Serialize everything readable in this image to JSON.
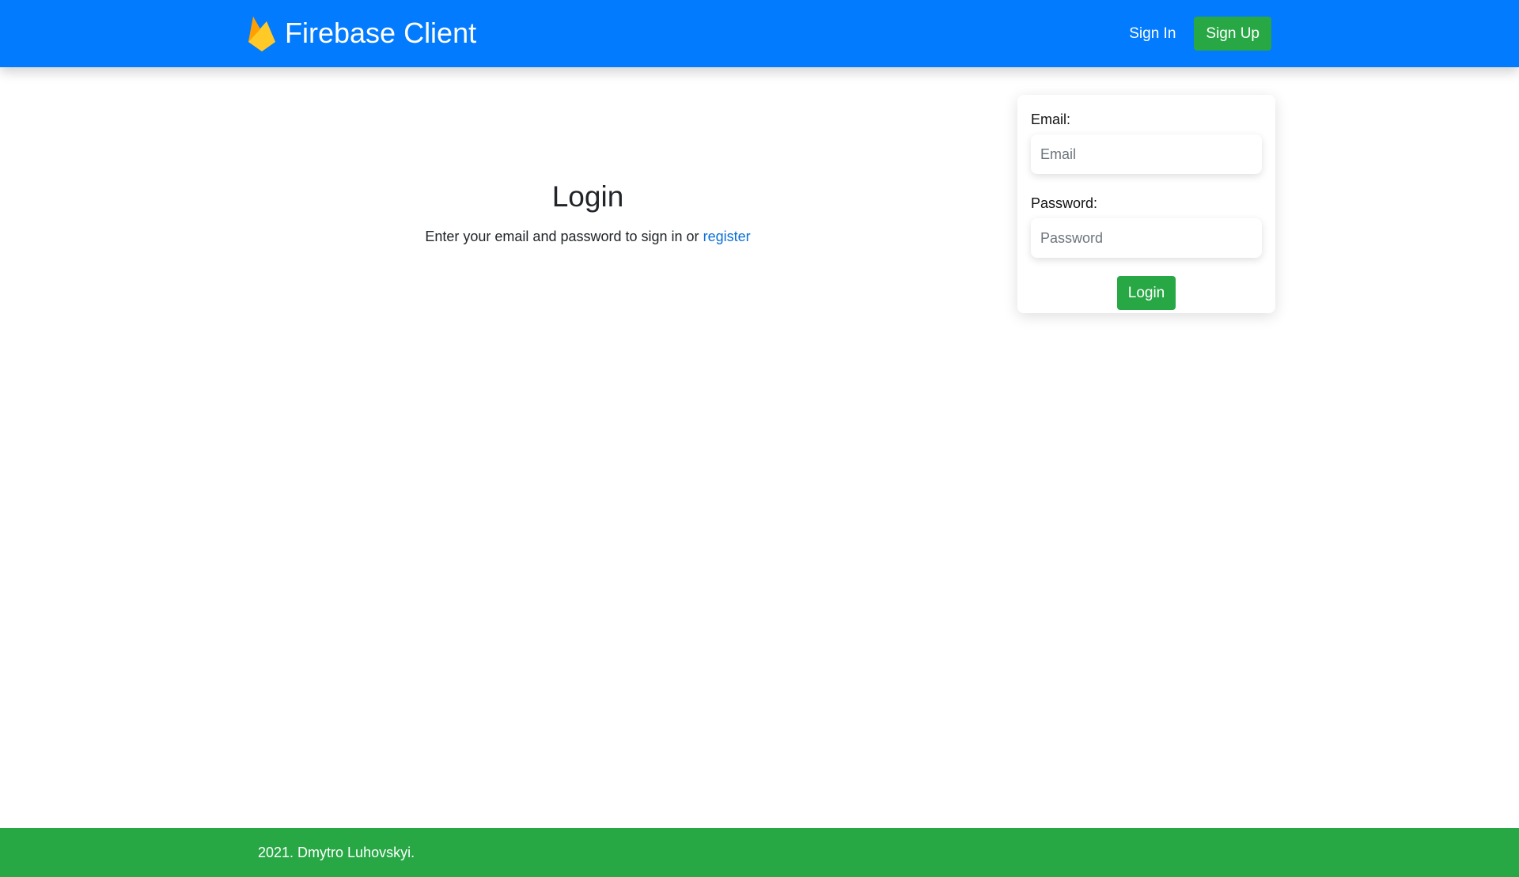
{
  "navbar": {
    "brand_name": "Firebase Client",
    "logo_icon": "firebase-flame-icon",
    "sign_in_label": "Sign In",
    "sign_up_label": "Sign Up",
    "background_color": "#037bfe"
  },
  "hero": {
    "title": "Login",
    "text": "Enter your email and password to sign in or",
    "register_link": "register"
  },
  "login_form": {
    "email_label": "Email:",
    "email_placeholder": "Email",
    "email_value": "",
    "password_label": "Password:",
    "password_placeholder": "Password",
    "password_value": "",
    "submit_label": "Login"
  },
  "footer": {
    "text": "2021. Dmytro Luhovskyi.",
    "background_color": "#28a745"
  },
  "colors": {
    "primary": "#037bfe",
    "success": "#28a745",
    "link": "#0a6fd6"
  }
}
